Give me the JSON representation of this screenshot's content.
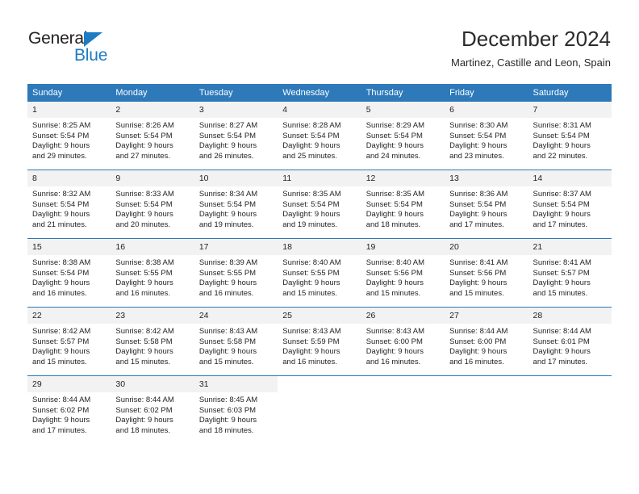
{
  "brand": {
    "name_top": "General",
    "name_bottom": "Blue",
    "accent_color": "#1d7cc4"
  },
  "header": {
    "title": "December 2024",
    "location": "Martinez, Castille and Leon, Spain"
  },
  "calendar": {
    "header_bg": "#2d79b9",
    "daynum_bg": "#f2f2f2",
    "weekday_headers": [
      "Sunday",
      "Monday",
      "Tuesday",
      "Wednesday",
      "Thursday",
      "Friday",
      "Saturday"
    ],
    "labels": {
      "sunrise": "Sunrise:",
      "sunset": "Sunset:",
      "daylight": "Daylight:"
    },
    "weeks": [
      [
        {
          "day": "1",
          "sunrise": "Sunrise: 8:25 AM",
          "sunset": "Sunset: 5:54 PM",
          "daylight_line1": "Daylight: 9 hours",
          "daylight_line2": "and 29 minutes."
        },
        {
          "day": "2",
          "sunrise": "Sunrise: 8:26 AM",
          "sunset": "Sunset: 5:54 PM",
          "daylight_line1": "Daylight: 9 hours",
          "daylight_line2": "and 27 minutes."
        },
        {
          "day": "3",
          "sunrise": "Sunrise: 8:27 AM",
          "sunset": "Sunset: 5:54 PM",
          "daylight_line1": "Daylight: 9 hours",
          "daylight_line2": "and 26 minutes."
        },
        {
          "day": "4",
          "sunrise": "Sunrise: 8:28 AM",
          "sunset": "Sunset: 5:54 PM",
          "daylight_line1": "Daylight: 9 hours",
          "daylight_line2": "and 25 minutes."
        },
        {
          "day": "5",
          "sunrise": "Sunrise: 8:29 AM",
          "sunset": "Sunset: 5:54 PM",
          "daylight_line1": "Daylight: 9 hours",
          "daylight_line2": "and 24 minutes."
        },
        {
          "day": "6",
          "sunrise": "Sunrise: 8:30 AM",
          "sunset": "Sunset: 5:54 PM",
          "daylight_line1": "Daylight: 9 hours",
          "daylight_line2": "and 23 minutes."
        },
        {
          "day": "7",
          "sunrise": "Sunrise: 8:31 AM",
          "sunset": "Sunset: 5:54 PM",
          "daylight_line1": "Daylight: 9 hours",
          "daylight_line2": "and 22 minutes."
        }
      ],
      [
        {
          "day": "8",
          "sunrise": "Sunrise: 8:32 AM",
          "sunset": "Sunset: 5:54 PM",
          "daylight_line1": "Daylight: 9 hours",
          "daylight_line2": "and 21 minutes."
        },
        {
          "day": "9",
          "sunrise": "Sunrise: 8:33 AM",
          "sunset": "Sunset: 5:54 PM",
          "daylight_line1": "Daylight: 9 hours",
          "daylight_line2": "and 20 minutes."
        },
        {
          "day": "10",
          "sunrise": "Sunrise: 8:34 AM",
          "sunset": "Sunset: 5:54 PM",
          "daylight_line1": "Daylight: 9 hours",
          "daylight_line2": "and 19 minutes."
        },
        {
          "day": "11",
          "sunrise": "Sunrise: 8:35 AM",
          "sunset": "Sunset: 5:54 PM",
          "daylight_line1": "Daylight: 9 hours",
          "daylight_line2": "and 19 minutes."
        },
        {
          "day": "12",
          "sunrise": "Sunrise: 8:35 AM",
          "sunset": "Sunset: 5:54 PM",
          "daylight_line1": "Daylight: 9 hours",
          "daylight_line2": "and 18 minutes."
        },
        {
          "day": "13",
          "sunrise": "Sunrise: 8:36 AM",
          "sunset": "Sunset: 5:54 PM",
          "daylight_line1": "Daylight: 9 hours",
          "daylight_line2": "and 17 minutes."
        },
        {
          "day": "14",
          "sunrise": "Sunrise: 8:37 AM",
          "sunset": "Sunset: 5:54 PM",
          "daylight_line1": "Daylight: 9 hours",
          "daylight_line2": "and 17 minutes."
        }
      ],
      [
        {
          "day": "15",
          "sunrise": "Sunrise: 8:38 AM",
          "sunset": "Sunset: 5:54 PM",
          "daylight_line1": "Daylight: 9 hours",
          "daylight_line2": "and 16 minutes."
        },
        {
          "day": "16",
          "sunrise": "Sunrise: 8:38 AM",
          "sunset": "Sunset: 5:55 PM",
          "daylight_line1": "Daylight: 9 hours",
          "daylight_line2": "and 16 minutes."
        },
        {
          "day": "17",
          "sunrise": "Sunrise: 8:39 AM",
          "sunset": "Sunset: 5:55 PM",
          "daylight_line1": "Daylight: 9 hours",
          "daylight_line2": "and 16 minutes."
        },
        {
          "day": "18",
          "sunrise": "Sunrise: 8:40 AM",
          "sunset": "Sunset: 5:55 PM",
          "daylight_line1": "Daylight: 9 hours",
          "daylight_line2": "and 15 minutes."
        },
        {
          "day": "19",
          "sunrise": "Sunrise: 8:40 AM",
          "sunset": "Sunset: 5:56 PM",
          "daylight_line1": "Daylight: 9 hours",
          "daylight_line2": "and 15 minutes."
        },
        {
          "day": "20",
          "sunrise": "Sunrise: 8:41 AM",
          "sunset": "Sunset: 5:56 PM",
          "daylight_line1": "Daylight: 9 hours",
          "daylight_line2": "and 15 minutes."
        },
        {
          "day": "21",
          "sunrise": "Sunrise: 8:41 AM",
          "sunset": "Sunset: 5:57 PM",
          "daylight_line1": "Daylight: 9 hours",
          "daylight_line2": "and 15 minutes."
        }
      ],
      [
        {
          "day": "22",
          "sunrise": "Sunrise: 8:42 AM",
          "sunset": "Sunset: 5:57 PM",
          "daylight_line1": "Daylight: 9 hours",
          "daylight_line2": "and 15 minutes."
        },
        {
          "day": "23",
          "sunrise": "Sunrise: 8:42 AM",
          "sunset": "Sunset: 5:58 PM",
          "daylight_line1": "Daylight: 9 hours",
          "daylight_line2": "and 15 minutes."
        },
        {
          "day": "24",
          "sunrise": "Sunrise: 8:43 AM",
          "sunset": "Sunset: 5:58 PM",
          "daylight_line1": "Daylight: 9 hours",
          "daylight_line2": "and 15 minutes."
        },
        {
          "day": "25",
          "sunrise": "Sunrise: 8:43 AM",
          "sunset": "Sunset: 5:59 PM",
          "daylight_line1": "Daylight: 9 hours",
          "daylight_line2": "and 16 minutes."
        },
        {
          "day": "26",
          "sunrise": "Sunrise: 8:43 AM",
          "sunset": "Sunset: 6:00 PM",
          "daylight_line1": "Daylight: 9 hours",
          "daylight_line2": "and 16 minutes."
        },
        {
          "day": "27",
          "sunrise": "Sunrise: 8:44 AM",
          "sunset": "Sunset: 6:00 PM",
          "daylight_line1": "Daylight: 9 hours",
          "daylight_line2": "and 16 minutes."
        },
        {
          "day": "28",
          "sunrise": "Sunrise: 8:44 AM",
          "sunset": "Sunset: 6:01 PM",
          "daylight_line1": "Daylight: 9 hours",
          "daylight_line2": "and 17 minutes."
        }
      ],
      [
        {
          "day": "29",
          "sunrise": "Sunrise: 8:44 AM",
          "sunset": "Sunset: 6:02 PM",
          "daylight_line1": "Daylight: 9 hours",
          "daylight_line2": "and 17 minutes."
        },
        {
          "day": "30",
          "sunrise": "Sunrise: 8:44 AM",
          "sunset": "Sunset: 6:02 PM",
          "daylight_line1": "Daylight: 9 hours",
          "daylight_line2": "and 18 minutes."
        },
        {
          "day": "31",
          "sunrise": "Sunrise: 8:45 AM",
          "sunset": "Sunset: 6:03 PM",
          "daylight_line1": "Daylight: 9 hours",
          "daylight_line2": "and 18 minutes."
        },
        {
          "day": "",
          "sunrise": "",
          "sunset": "",
          "daylight_line1": "",
          "daylight_line2": ""
        },
        {
          "day": "",
          "sunrise": "",
          "sunset": "",
          "daylight_line1": "",
          "daylight_line2": ""
        },
        {
          "day": "",
          "sunrise": "",
          "sunset": "",
          "daylight_line1": "",
          "daylight_line2": ""
        },
        {
          "day": "",
          "sunrise": "",
          "sunset": "",
          "daylight_line1": "",
          "daylight_line2": ""
        }
      ]
    ]
  }
}
